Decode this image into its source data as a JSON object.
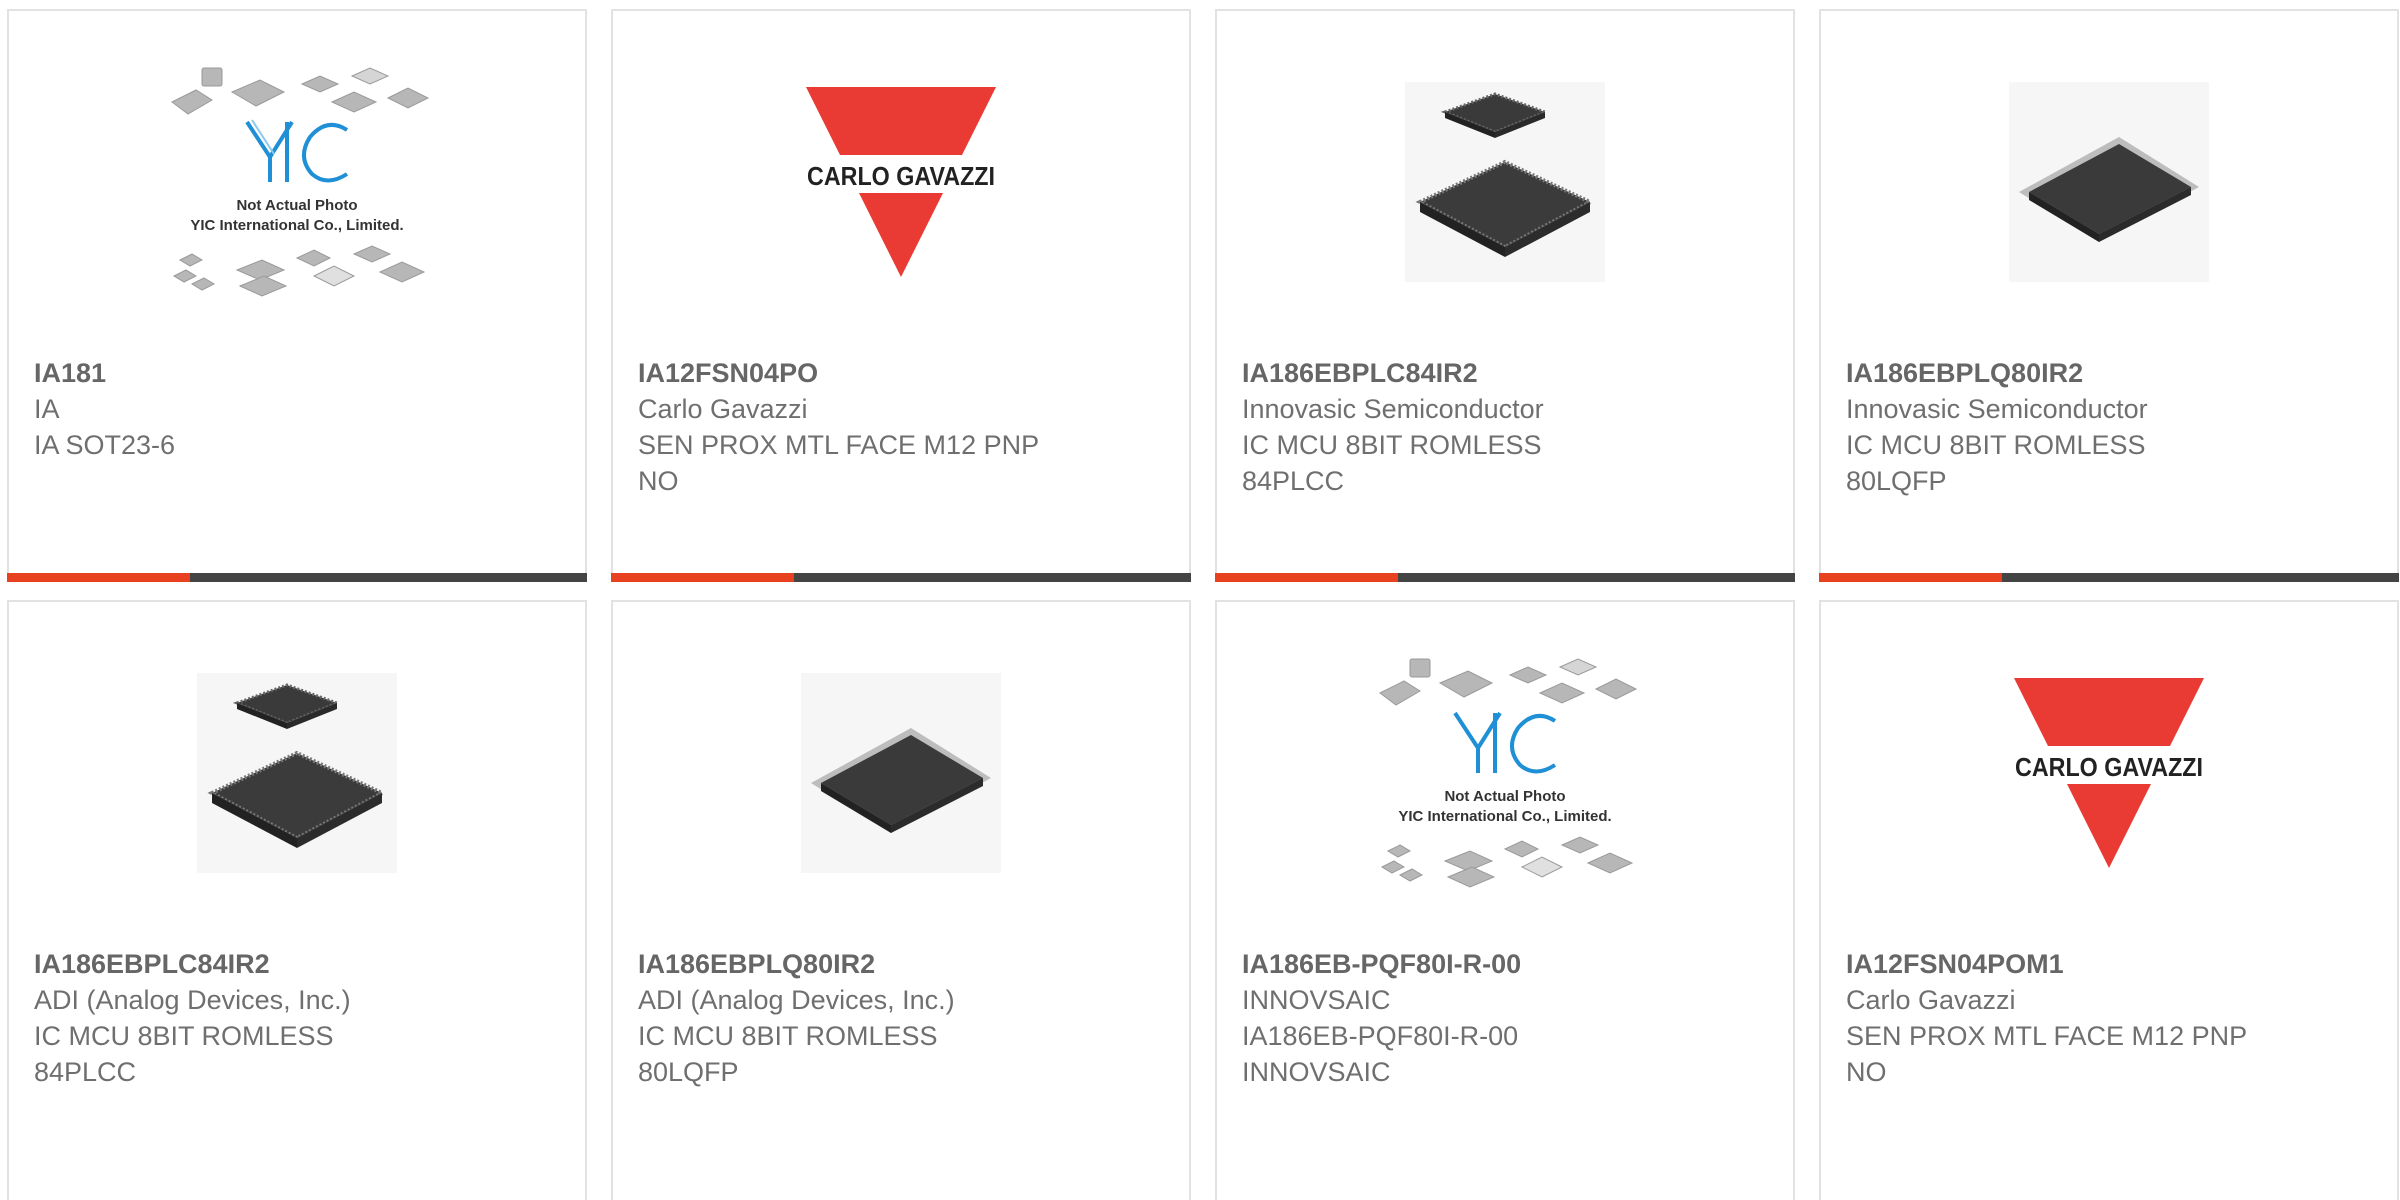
{
  "colors": {
    "accent": "#e8411f",
    "bar_dark": "#444444",
    "gavazzi_red": "#e93a34",
    "yic_blue": "#1f8fd6"
  },
  "products": [
    {
      "part": "IA181",
      "lines": [
        "IA",
        "IA SOT23-6"
      ],
      "image": "yic-not-actual-photo",
      "photo_text": [
        "Not Actual Photo",
        "YIC International Co., Limited."
      ]
    },
    {
      "part": "IA12FSN04PO",
      "lines": [
        "Carlo Gavazzi",
        "SEN PROX MTL FACE M12 PNP",
        "NO"
      ],
      "image": "carlo-gavazzi-logo",
      "photo_text": [
        "CARLO GAVAZZI"
      ]
    },
    {
      "part": "IA186EBPLC84IR2",
      "lines": [
        "Innovasic Semiconductor",
        "IC MCU 8BIT ROMLESS",
        "84PLCC"
      ],
      "image": "plcc-chip-photo"
    },
    {
      "part": "IA186EBPLQ80IR2",
      "lines": [
        "Innovasic Semiconductor",
        "IC MCU 8BIT ROMLESS",
        "80LQFP"
      ],
      "image": "lqfp-chip-photo"
    },
    {
      "part": "IA186EBPLC84IR2",
      "lines": [
        "ADI (Analog Devices, Inc.)",
        "IC MCU 8BIT ROMLESS",
        "84PLCC"
      ],
      "image": "plcc-chip-photo"
    },
    {
      "part": "IA186EBPLQ80IR2",
      "lines": [
        "ADI (Analog Devices, Inc.)",
        "IC MCU 8BIT ROMLESS",
        "80LQFP"
      ],
      "image": "lqfp-chip-photo"
    },
    {
      "part": "IA186EB-PQF80I-R-00",
      "lines": [
        "INNOVSAIC",
        "IA186EB-PQF80I-R-00",
        "INNOVSAIC"
      ],
      "image": "yic-not-actual-photo",
      "photo_text": [
        "Not Actual Photo",
        "YIC International Co., Limited."
      ]
    },
    {
      "part": "IA12FSN04POM1",
      "lines": [
        "Carlo Gavazzi",
        "SEN PROX MTL FACE M12 PNP",
        "NO"
      ],
      "image": "carlo-gavazzi-logo",
      "photo_text": [
        "CARLO GAVAZZI"
      ]
    }
  ]
}
